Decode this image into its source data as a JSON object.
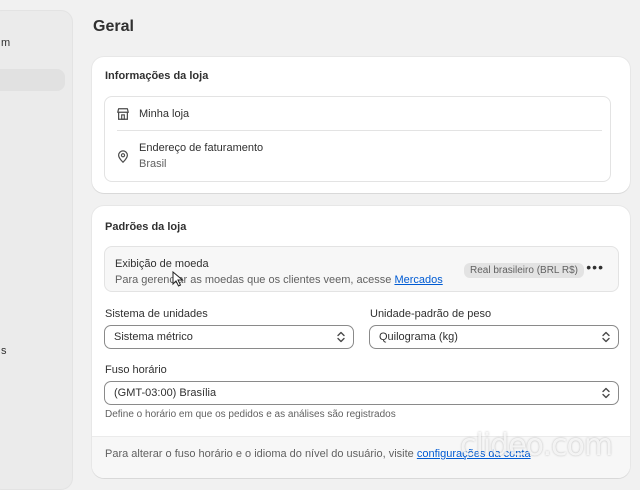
{
  "sidebar": {
    "text_top": "m",
    "text_bottom": "s"
  },
  "page": {
    "title": "Geral"
  },
  "store_info": {
    "title": "Informações da loja",
    "store_name": "Minha loja",
    "store_icon": "store-icon",
    "billing_label": "Endereço de faturamento",
    "billing_value": "Brasil",
    "billing_icon": "location-pin-icon"
  },
  "store_defaults": {
    "title": "Padrões da loja",
    "currency": {
      "label": "Exibição de moeda",
      "description": "Para gerenciar as moedas que os clientes veem, acesse",
      "link": "Mercados",
      "badge": "Real brasileiro (BRL R$)",
      "more_icon": "more-horizontal-icon"
    },
    "unit_system": {
      "label": "Sistema de unidades",
      "value": "Sistema métrico"
    },
    "weight_unit": {
      "label": "Unidade-padrão de peso",
      "value": "Quilograma (kg)"
    },
    "timezone": {
      "label": "Fuso horário",
      "value": "(GMT-03:00) Brasília",
      "help": "Define o horário em que os pedidos e as análises são registrados"
    },
    "footer": {
      "text": "Para alterar o fuso horário e o idioma do nível do usuário, visite",
      "link": "configurações da conta"
    }
  },
  "watermark": "clideo.com",
  "colors": {
    "link": "#005bd3",
    "background": "#f1f1f1",
    "card": "#ffffff"
  }
}
